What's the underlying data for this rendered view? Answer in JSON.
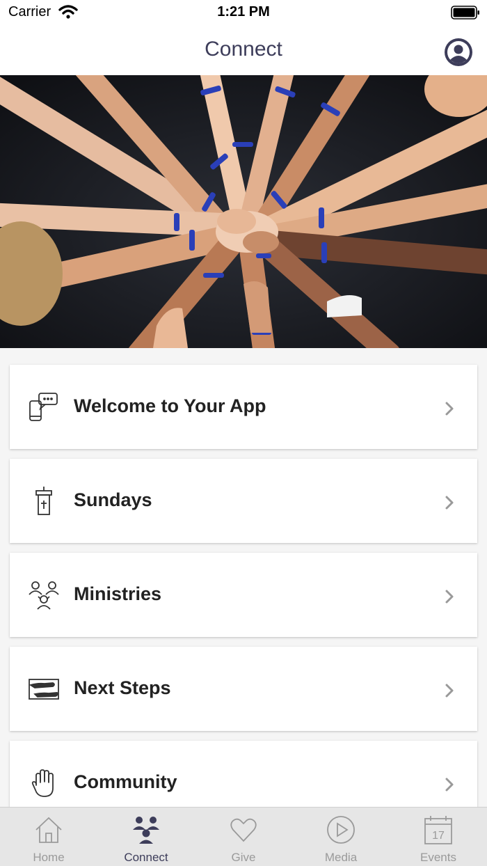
{
  "status_bar": {
    "carrier": "Carrier",
    "time": "1:21 PM"
  },
  "nav": {
    "title": "Connect"
  },
  "menu_items": [
    {
      "label": "Welcome to Your App",
      "icon": "chat-phone-icon"
    },
    {
      "label": "Sundays",
      "icon": "pulpit-icon"
    },
    {
      "label": "Ministries",
      "icon": "people-group-icon"
    },
    {
      "label": "Next Steps",
      "icon": "steps-icon"
    },
    {
      "label": "Community",
      "icon": "raised-hand-icon"
    }
  ],
  "tabs": [
    {
      "label": "Home",
      "icon": "home-icon",
      "active": false
    },
    {
      "label": "Connect",
      "icon": "group-icon",
      "active": true
    },
    {
      "label": "Give",
      "icon": "heart-icon",
      "active": false
    },
    {
      "label": "Media",
      "icon": "play-icon",
      "active": false
    },
    {
      "label": "Events",
      "icon": "calendar-icon",
      "active": false,
      "badge": "17"
    }
  ],
  "colors": {
    "accent": "#3d3d5a",
    "inactive": "#9a9a9a",
    "tab_bar_bg": "#e6e6e6"
  }
}
